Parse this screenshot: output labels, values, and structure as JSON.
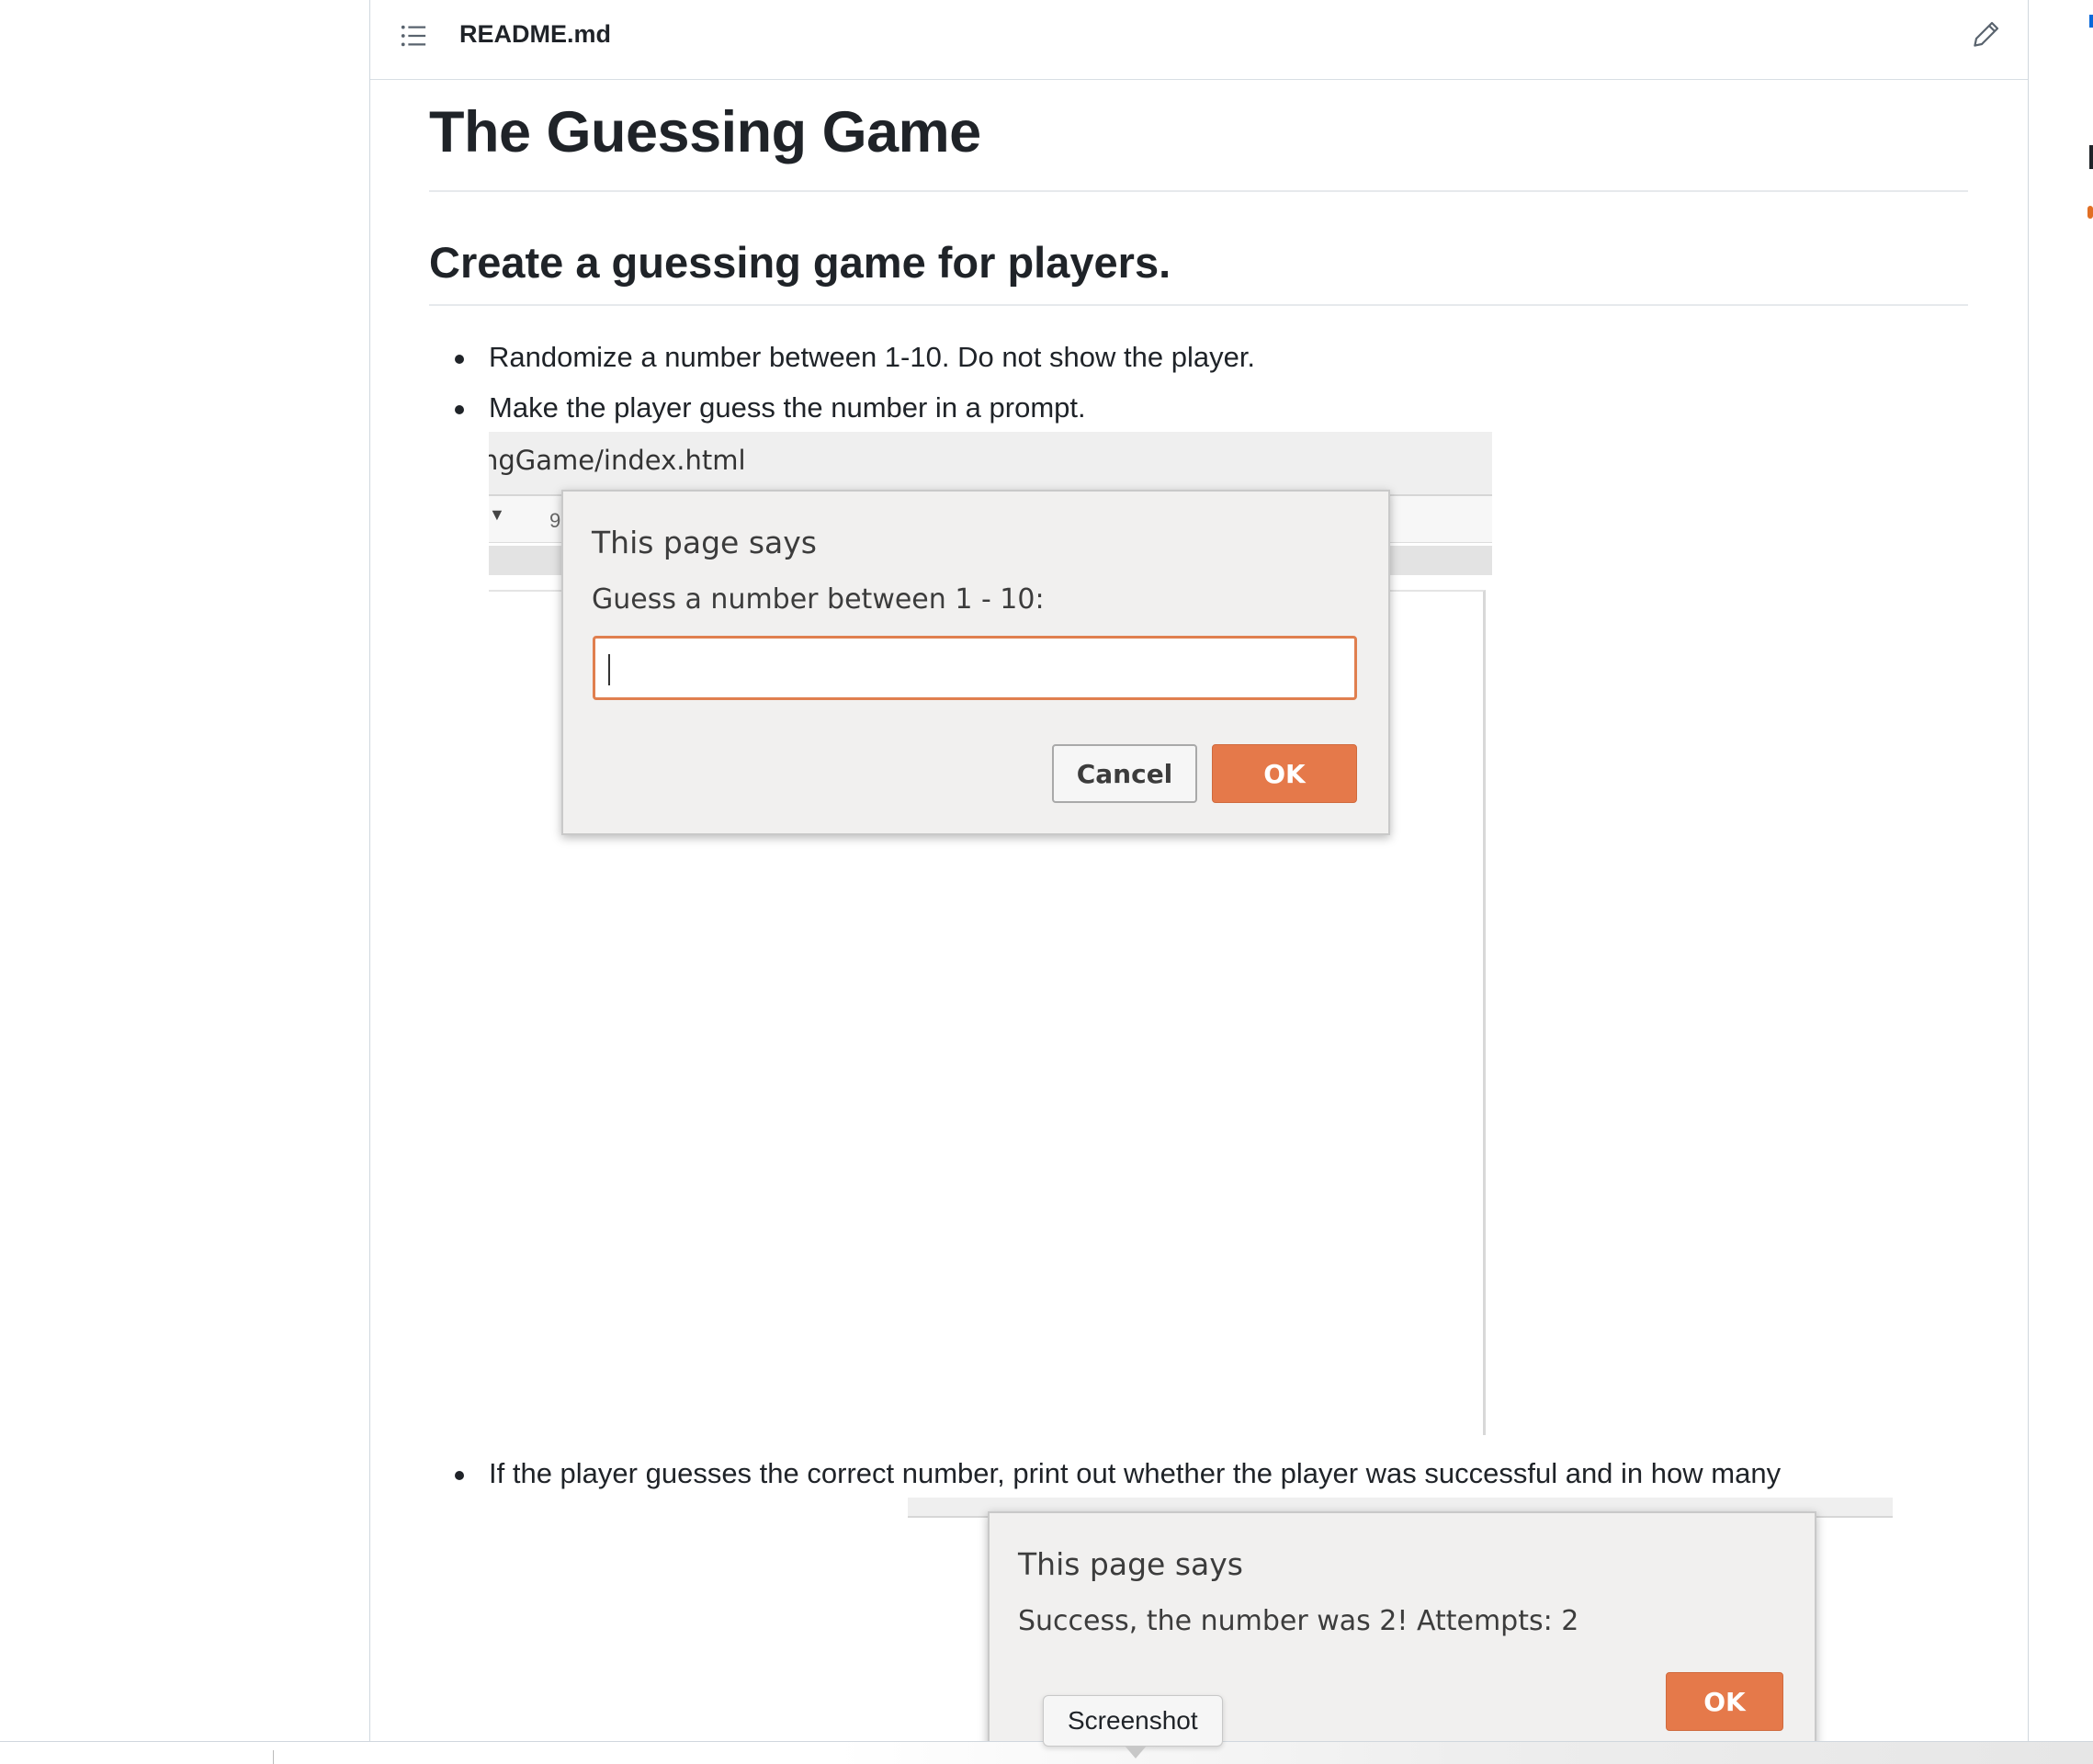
{
  "readme": {
    "filename": "README.md"
  },
  "article": {
    "title": "The Guessing Game",
    "subtitle": "Create a guessing game for players.",
    "bullets": [
      "Randomize a number between 1-10. Do not show the player.",
      "Make the player guess the number in a prompt.",
      "If the player guesses the correct number, print out whether the player was successful and in how many"
    ]
  },
  "screenshot1": {
    "url_fragment": "ngGame/index.html",
    "toolbar_char": "9",
    "dialog": {
      "title": "This page says",
      "message": "Guess a number between 1 - 10:",
      "input_value": "",
      "cancel_label": "Cancel",
      "ok_label": "OK"
    }
  },
  "screenshot2": {
    "dialog": {
      "title": "This page says",
      "message": "Success, the number was 2! Attempts: 2",
      "ok_label": "OK"
    }
  },
  "tooltip": {
    "label": "Screenshot"
  },
  "colors": {
    "accent_orange": "#e5794a",
    "link_blue": "#0969da",
    "text": "#1f2328"
  },
  "icons": {
    "toc": "list-unordered-icon",
    "edit": "pencil-icon"
  }
}
